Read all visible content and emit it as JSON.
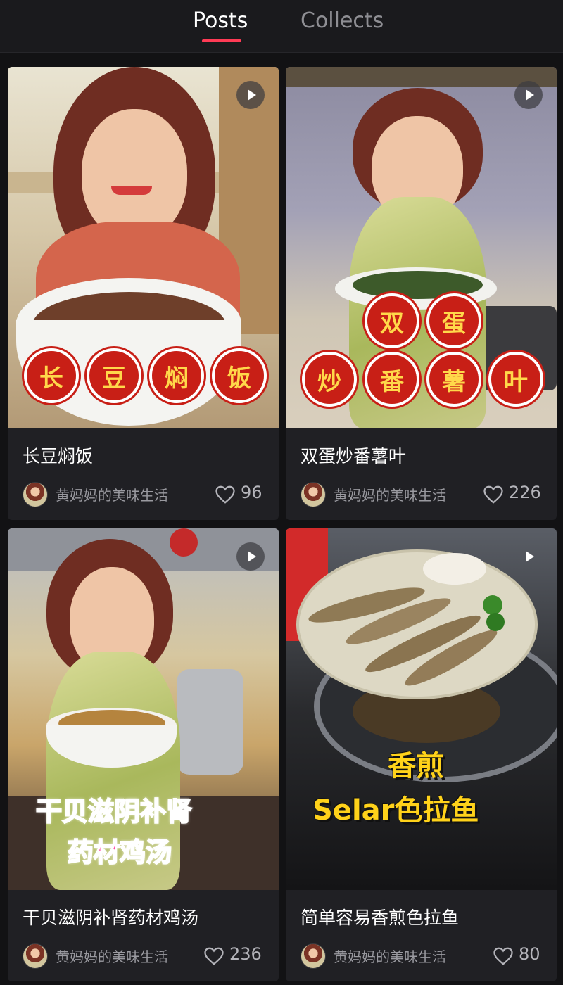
{
  "tabs": [
    {
      "label": "Posts",
      "active": true
    },
    {
      "label": "Collects",
      "active": false
    }
  ],
  "accent_color": "#ff3b55",
  "posts": [
    {
      "title": "长豆焖饭",
      "author": "黄妈妈的美味生活",
      "likes": "96",
      "overlay_chars": [
        "长",
        "豆",
        "焖",
        "饭"
      ]
    },
    {
      "title": "双蛋炒番薯叶",
      "author": "黄妈妈的美味生活",
      "likes": "226",
      "overlay_chars": [
        "双",
        "蛋",
        "炒",
        "番",
        "薯",
        "叶"
      ]
    },
    {
      "title": "干贝滋阴补肾药材鸡汤",
      "author": "黄妈妈的美味生活",
      "likes": "236",
      "overlay_lines": [
        "干贝滋阴补肾",
        "药材鸡汤"
      ]
    },
    {
      "title": "简单容易香煎色拉鱼",
      "author": "黄妈妈的美味生活",
      "likes": "80",
      "overlay_lines": [
        "香煎",
        "Selar色拉鱼"
      ]
    }
  ]
}
